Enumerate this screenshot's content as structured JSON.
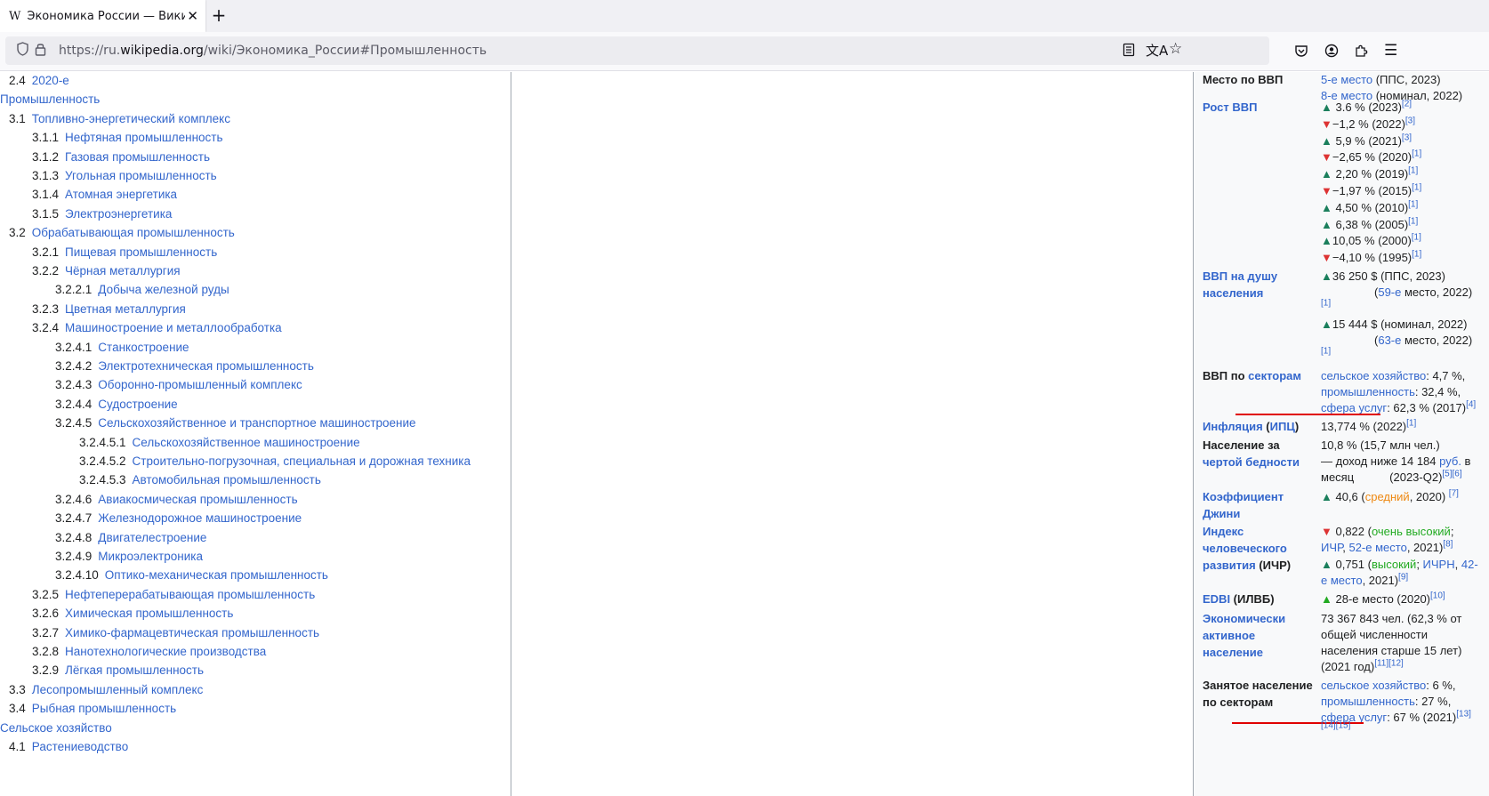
{
  "browser": {
    "tab_title": "Экономика России — Википедия",
    "tab_favicon": "W",
    "url_prefix": "https://ru.",
    "url_domain": "wikipedia.org",
    "url_path": "/wiki/Экономика_России#Промышленность"
  },
  "toc": [
    {
      "num": "2.4",
      "label": "2020-е",
      "level": 1
    },
    {
      "num": "",
      "label": "Промышленность",
      "level": 0
    },
    {
      "num": "3.1",
      "label": "Топливно-энергетический комплекс",
      "level": 1
    },
    {
      "num": "3.1.1",
      "label": "Нефтяная промышленность",
      "level": 2
    },
    {
      "num": "3.1.2",
      "label": "Газовая промышленность",
      "level": 2
    },
    {
      "num": "3.1.3",
      "label": "Угольная промышленность",
      "level": 2
    },
    {
      "num": "3.1.4",
      "label": "Атомная энергетика",
      "level": 2
    },
    {
      "num": "3.1.5",
      "label": "Электроэнергетика",
      "level": 2
    },
    {
      "num": "3.2",
      "label": "Обрабатывающая промышленность",
      "level": 1
    },
    {
      "num": "3.2.1",
      "label": "Пищевая промышленность",
      "level": 2
    },
    {
      "num": "3.2.2",
      "label": "Чёрная металлургия",
      "level": 2
    },
    {
      "num": "3.2.2.1",
      "label": "Добыча железной руды",
      "level": 3
    },
    {
      "num": "3.2.3",
      "label": "Цветная металлургия",
      "level": 2
    },
    {
      "num": "3.2.4",
      "label": "Машиностроение и металлообработка",
      "level": 2
    },
    {
      "num": "3.2.4.1",
      "label": "Станкостроение",
      "level": 3
    },
    {
      "num": "3.2.4.2",
      "label": "Электротехническая промышленность",
      "level": 3
    },
    {
      "num": "3.2.4.3",
      "label": "Оборонно-промышленный комплекс",
      "level": 3
    },
    {
      "num": "3.2.4.4",
      "label": "Судостроение",
      "level": 3
    },
    {
      "num": "3.2.4.5",
      "label": "Сельскохозяйственное и транспортное машиностроение",
      "level": 3
    },
    {
      "num": "3.2.4.5.1",
      "label": "Сельскохозяйственное машиностроение",
      "level": 4
    },
    {
      "num": "3.2.4.5.2",
      "label": "Строительно-погрузочная, специальная и дорожная техника",
      "level": 4
    },
    {
      "num": "3.2.4.5.3",
      "label": "Автомобильная промышленность",
      "level": 4
    },
    {
      "num": "3.2.4.6",
      "label": "Авиакосмическая промышленность",
      "level": 3
    },
    {
      "num": "3.2.4.7",
      "label": "Железнодорожное машиностроение",
      "level": 3
    },
    {
      "num": "3.2.4.8",
      "label": "Двигателестроение",
      "level": 3
    },
    {
      "num": "3.2.4.9",
      "label": "Микроэлектроника",
      "level": 3
    },
    {
      "num": "3.2.4.10",
      "label": "Оптико-механическая промышленность",
      "level": 3
    },
    {
      "num": "3.2.5",
      "label": "Нефтеперерабатывающая промышленность",
      "level": 2
    },
    {
      "num": "3.2.6",
      "label": "Химическая промышленность",
      "level": 2
    },
    {
      "num": "3.2.7",
      "label": "Химико-фармацевтическая промышленность",
      "level": 2
    },
    {
      "num": "3.2.8",
      "label": "Нанотехнологические производства",
      "level": 2
    },
    {
      "num": "3.2.9",
      "label": "Лёгкая промышленность",
      "level": 2
    },
    {
      "num": "3.3",
      "label": "Лесопромышленный комплекс",
      "level": 1
    },
    {
      "num": "3.4",
      "label": "Рыбная промышленность",
      "level": 1
    },
    {
      "num": "",
      "label": "Сельское хозяйство",
      "level": 0
    },
    {
      "num": "4.1",
      "label": "Растениеводство",
      "level": 1
    }
  ],
  "infobox": {
    "gdp_rank_label": "Место по ВВП",
    "gdp_rank_1_link": "5-е место",
    "gdp_rank_1_rest": " (ППС, 2023)",
    "gdp_rank_2_link": "8-е место",
    "gdp_rank_2_rest": " (номинал, 2022)",
    "gdp_growth_label": "Рост ВВП",
    "gdp_growth": [
      {
        "dir": "up",
        "text": " 3.6 % (2023)",
        "ref": "[2]"
      },
      {
        "dir": "down",
        "text": "−1,2 % (2022)",
        "ref": "[3]"
      },
      {
        "dir": "up",
        "text": " 5,9 % (2021)",
        "ref": "[3]"
      },
      {
        "dir": "down",
        "text": "−2,65 % (2020)",
        "ref": "[1]"
      },
      {
        "dir": "up",
        "text": " 2,20 % (2019)",
        "ref": "[1]"
      },
      {
        "dir": "down",
        "text": "−1,97 % (2015)",
        "ref": "[1]"
      },
      {
        "dir": "up",
        "text": " 4,50 % (2010)",
        "ref": "[1]"
      },
      {
        "dir": "up",
        "text": " 6,38 % (2005)",
        "ref": "[1]"
      },
      {
        "dir": "up",
        "text": "10,05 % (2000)",
        "ref": "[1]"
      },
      {
        "dir": "down",
        "text": "−4,10 % (1995)",
        "ref": "[1]"
      }
    ],
    "gdp_pc_label": "ВВП на душу населения",
    "gdp_pc_1": "36 250 $ (ППС, 2023)",
    "gdp_pc_1_rank_link": "59-е",
    "gdp_pc_1_rank_rest": " место, 2022)",
    "gdp_pc_2": "15 444 $ (номинал, 2022)",
    "gdp_pc_2_rank_link": "63-е",
    "gdp_pc_2_rank_rest": " место, 2022)",
    "ref1": "[1]",
    "sectors_label_a": "ВВП по ",
    "sectors_label_b": "секторам",
    "sector_agri_link": "сельское хозяйство",
    "sector_agri_val": ": 4,7 %,",
    "sector_ind_link": "промышленность",
    "sector_ind_val": ": 32,4 %,",
    "sector_serv_link": "сфера услуг",
    "sector_serv_val": ": 62,3 % (2017)",
    "sector_ref": "[4]",
    "inflation_label_a": "Инфляция",
    "inflation_label_b": "ИПЦ",
    "inflation_val": "13,774 % (2022)",
    "inflation_ref": "[1]",
    "poverty_label_a": "Население за",
    "poverty_label_b": "чертой бедности",
    "poverty_1": "10,8 % (15,7 млн чел.)",
    "poverty_2a": "— доход ниже 14 184 ",
    "poverty_2b": "руб.",
    "poverty_2c": " в",
    "poverty_3a": "месяц",
    "poverty_3b": "(2023-Q2)",
    "poverty_ref": "[5][6]",
    "gini_label": "Коэффициент Джини",
    "gini_val_a": " 40,6 (",
    "gini_val_b": "средний",
    "gini_val_c": ", 2020) ",
    "gini_ref": "[7]",
    "hdi_label_a": "Индекс человеческого развития",
    "hdi_label_b": " (ИЧР)",
    "hdi_1a": " 0,822 (",
    "hdi_1b": "очень высокий",
    "hdi_1c": ";",
    "hdi_2a": "ИЧР",
    "hdi_2b": ", ",
    "hdi_2c": "52-е место",
    "hdi_2d": ", 2021)",
    "hdi_2ref": "[8]",
    "hdi_3a": " 0,751 (",
    "hdi_3b": "высокий",
    "hdi_3c": "; ",
    "hdi_3d": "ИЧРН",
    "hdi_3e": ", ",
    "hdi_3f": "42-",
    "hdi_4a": "е место",
    "hdi_4b": ", 2021)",
    "hdi_4ref": "[9]",
    "edbi_label_a": "EDBI",
    "edbi_label_b": " (ИЛВБ)",
    "edbi_val": " 28-е место (2020)",
    "edbi_ref": "[10]",
    "labor_label": "Экономически активное население",
    "labor_1": "73 367 843 чел. (62,3 % от",
    "labor_2": "общей численности",
    "labor_3": "населения старше 15 лет)",
    "labor_4": "(2021 год)",
    "labor_ref": "[11][12]",
    "employed_label": "Занятое население по секторам",
    "emp_agri_link": "сельское хозяйство",
    "emp_agri_val": ": 6 %,",
    "emp_ind_link": "промышленность",
    "emp_ind_val": ": 27 %,",
    "emp_serv_link": "сфера услуг",
    "emp_serv_val": ": 67 % (2021)",
    "emp_ref": "[13]",
    "emp_ref2": "[14][15]"
  },
  "colors": {
    "link": "#3366cc",
    "up_arrow": "#1b7f5c",
    "down_arrow": "#dd3333",
    "annotation_underline": "#e00000",
    "orange": "#ee8811",
    "green": "#22aa22"
  }
}
